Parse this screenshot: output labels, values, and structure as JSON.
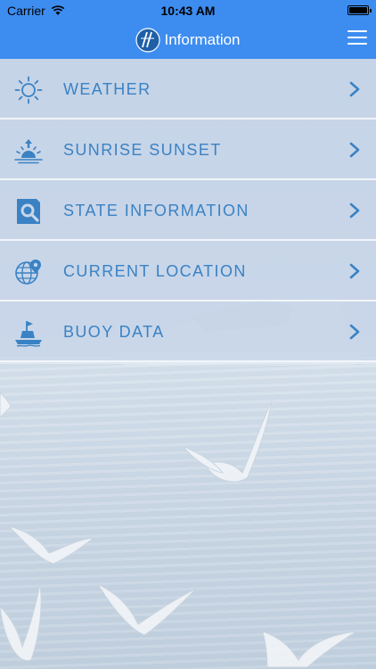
{
  "status_bar": {
    "carrier": "Carrier",
    "time": "10:43 AM",
    "battery_level": 1.0
  },
  "nav_bar": {
    "title": "Information",
    "logo_icon": "stylized-w-logo-icon",
    "menu_icon": "hamburger-menu-icon"
  },
  "menu": {
    "items": [
      {
        "label": "WEATHER",
        "icon": "sun-icon"
      },
      {
        "label": "SUNRISE SUNSET",
        "icon": "sunrise-icon"
      },
      {
        "label": "STATE INFORMATION",
        "icon": "magnifier-document-icon"
      },
      {
        "label": "CURRENT LOCATION",
        "icon": "globe-pin-icon"
      },
      {
        "label": "BUOY DATA",
        "icon": "buoy-icon"
      }
    ],
    "chevron_icon": "chevron-right-icon"
  },
  "colors": {
    "nav_background": "#3d8df0",
    "item_text": "#3a82c4",
    "icon_color": "#3a82c4"
  }
}
